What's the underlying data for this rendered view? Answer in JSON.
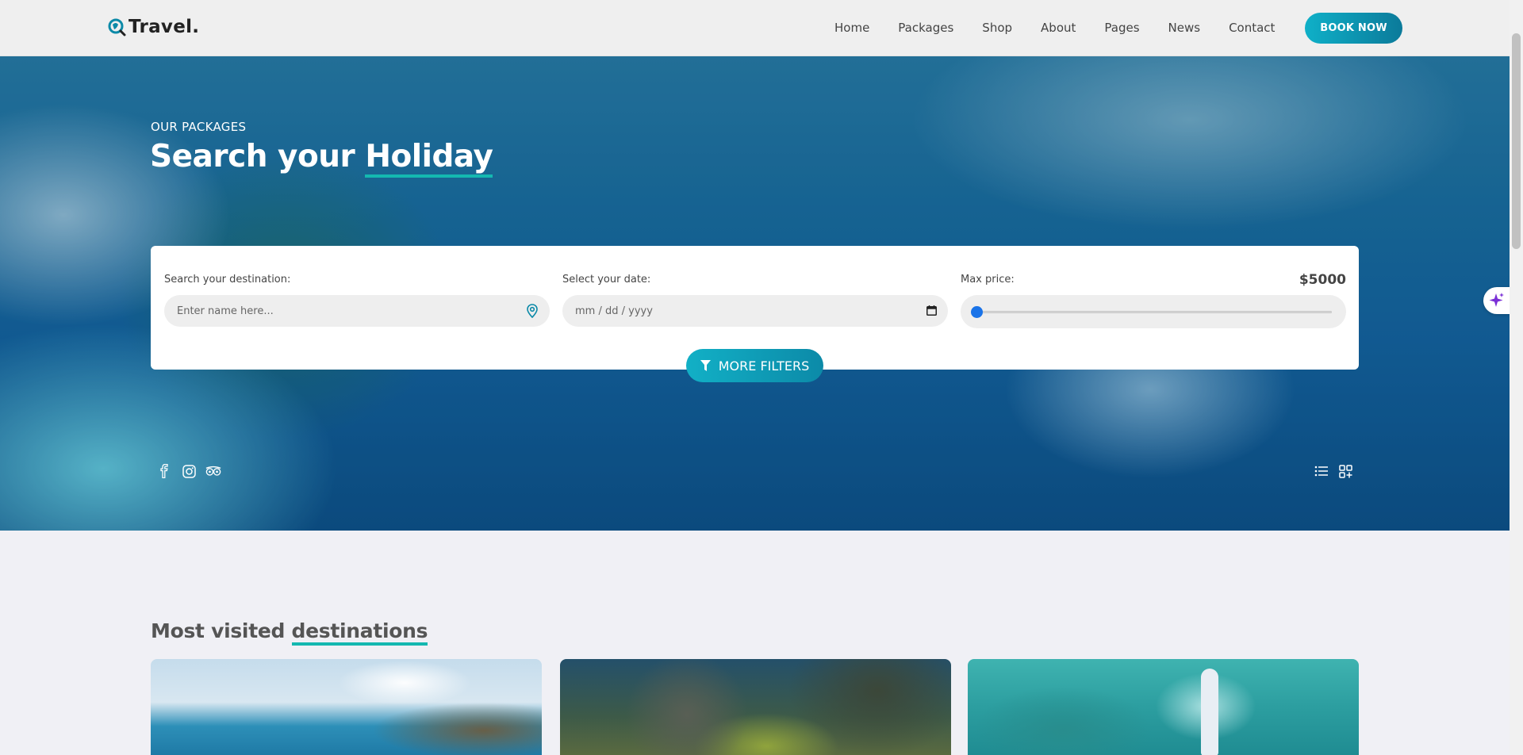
{
  "header": {
    "logo_text": "Travel.",
    "nav": [
      "Home",
      "Packages",
      "Shop",
      "About",
      "Pages",
      "News",
      "Contact"
    ],
    "book_label": "BOOK NOW"
  },
  "hero": {
    "subtitle": "OUR PACKAGES",
    "title_part1": "Search your ",
    "title_highlight": "Holiday"
  },
  "search": {
    "destination_label": "Search your destination:",
    "destination_placeholder": "Enter name here...",
    "date_label": "Select your date:",
    "date_placeholder": "mm / dd / yyyy",
    "price_label": "Max price:",
    "price_value": "$5000",
    "price_slider_fraction": 0,
    "filters_label": "MORE FILTERS"
  },
  "icons": {
    "social": [
      "facebook-icon",
      "instagram-icon",
      "tripadvisor-icon"
    ],
    "views": [
      "list-view-icon",
      "grid-view-icon"
    ]
  },
  "destinations": {
    "title_part1": "Most visited ",
    "title_highlight": "destinations"
  },
  "colors": {
    "accent": "#0fb0c8",
    "accent_dark": "#0b7a9a",
    "underline": "#14b8b0",
    "slider_thumb": "#1a73e8"
  }
}
